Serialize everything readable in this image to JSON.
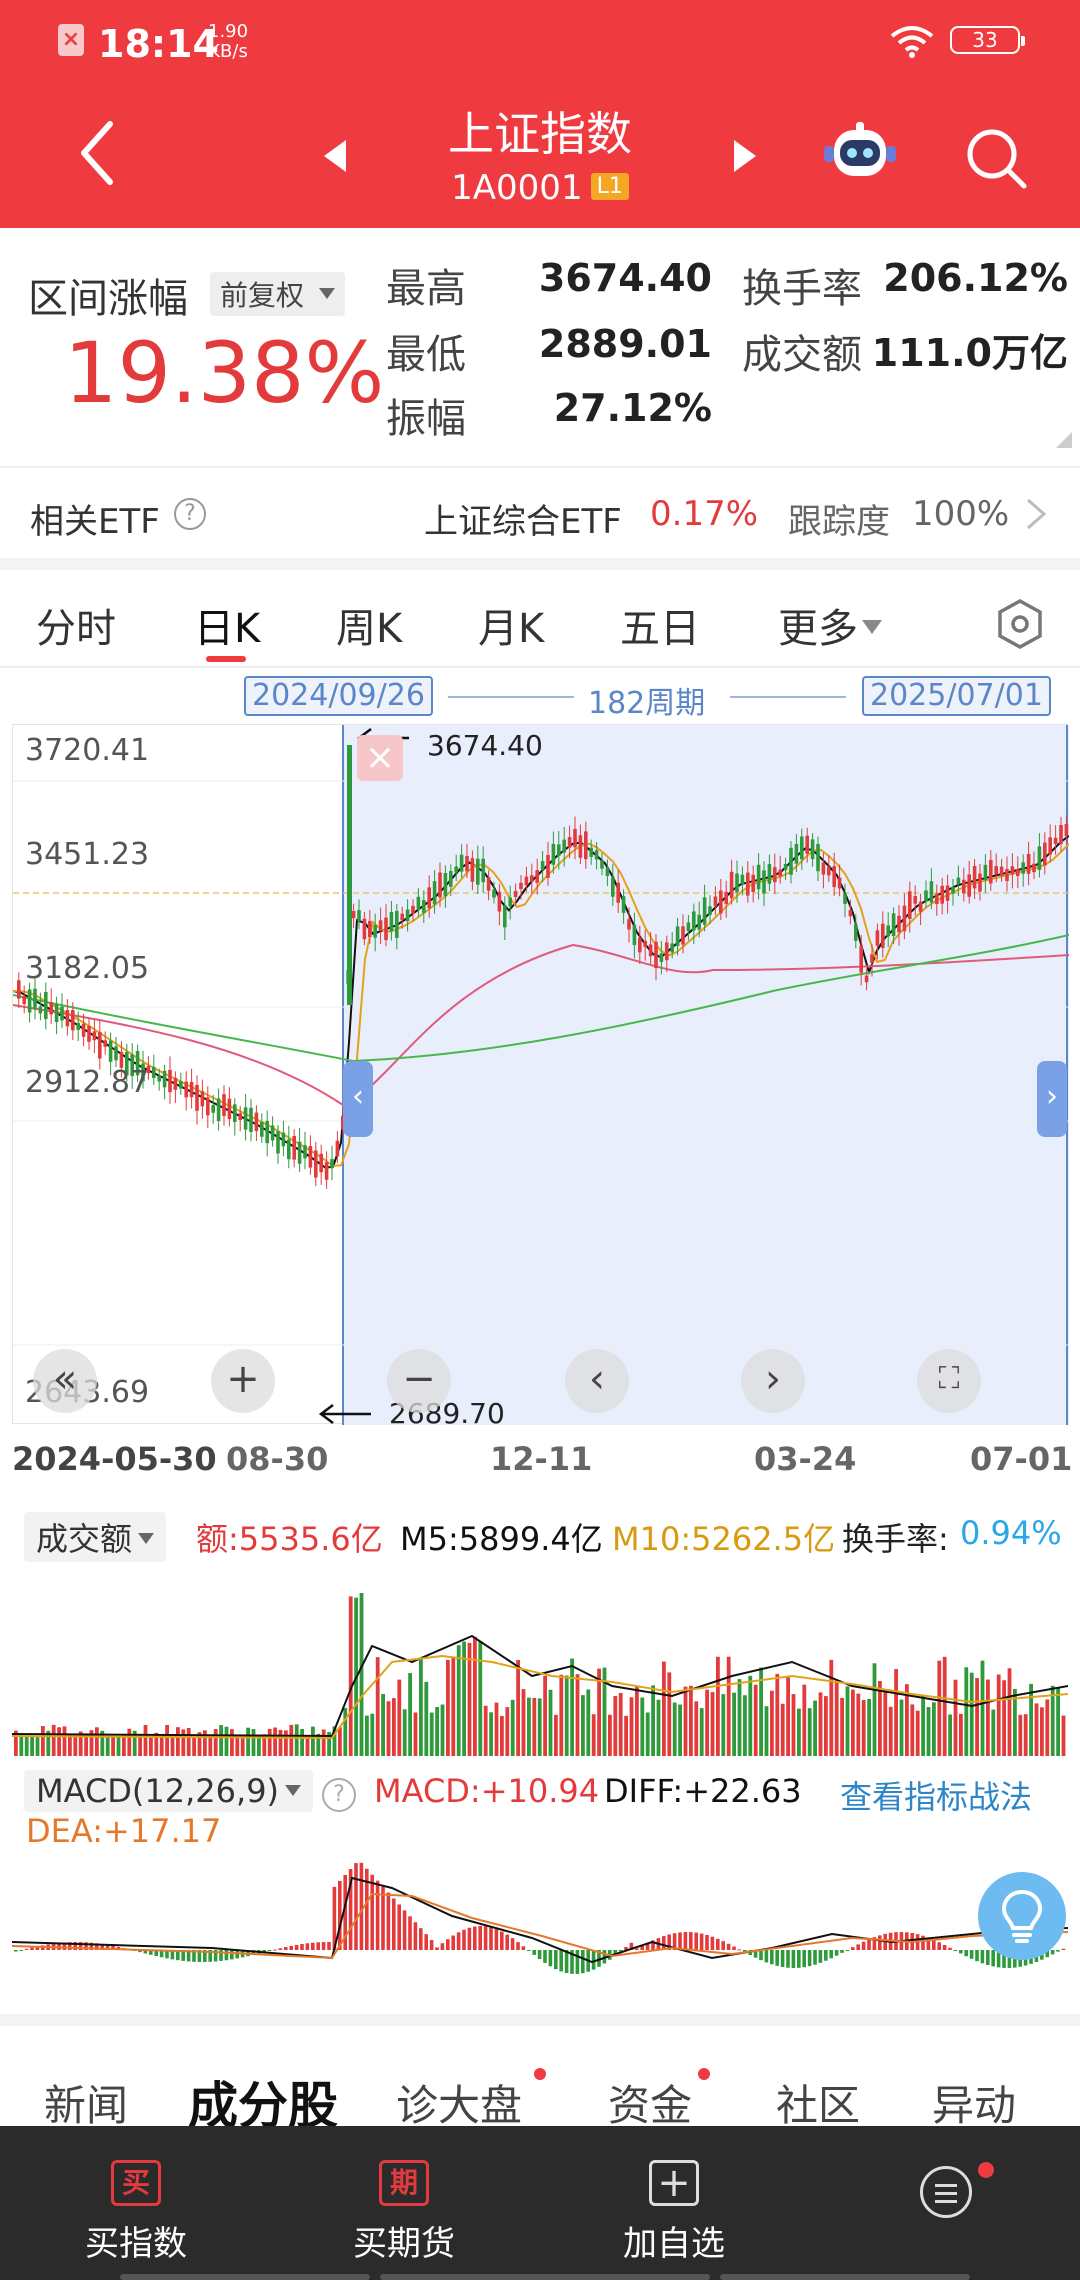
{
  "status": {
    "time": "18:14",
    "speed_value": "1.90",
    "speed_unit": "KB/s",
    "battery": "33"
  },
  "header": {
    "title": "上证指数",
    "code": "1A0001",
    "level": "L1"
  },
  "summary": {
    "range_label": "区间涨幅",
    "adj_label": "前复权",
    "range_change": "19.38%",
    "high_label": "最高",
    "high": "3674.40",
    "low_label": "最低",
    "low": "2889.01",
    "amp_label": "振幅",
    "amp": "27.12%",
    "turnover_label": "换手率",
    "turnover": "206.12%",
    "amount_label": "成交额",
    "amount": "111.0万亿"
  },
  "etf": {
    "label": "相关ETF",
    "name": "上证综合ETF",
    "change": "0.17%",
    "track_label": "跟踪度",
    "track": "100%"
  },
  "tabs": [
    "分时",
    "日K",
    "周K",
    "月K",
    "五日",
    "更多"
  ],
  "period": {
    "start": "2024/09/26",
    "label": "182周期",
    "end": "2025/07/01"
  },
  "chart": {
    "y_labels": [
      "3720.41",
      "3451.23",
      "3182.05",
      "2912.87",
      "2643.69"
    ],
    "high_marker": "3674.40",
    "low_marker": "2689.70",
    "x_labels": [
      "2024-05-30",
      "08-30",
      "12-11",
      "03-24",
      "07-01"
    ]
  },
  "volume": {
    "selector": "成交额",
    "amount": "额:5535.6亿",
    "m5": "M5:5899.4亿",
    "m10": "M10:5262.5亿",
    "turnover_label": "换手率:",
    "turnover": "0.94%"
  },
  "macd": {
    "selector": "MACD(12,26,9)",
    "macd": "MACD:+10.94",
    "diff": "DIFF:+22.63",
    "link": "查看指标战法",
    "dea": "DEA:+17.17"
  },
  "bottom_tabs": [
    "新闻",
    "成分股",
    "诊大盘",
    "资金",
    "社区",
    "异动"
  ],
  "bottom_bar": {
    "items": [
      {
        "icon": "买",
        "label": "买指数"
      },
      {
        "icon": "期",
        "label": "买期货"
      },
      {
        "icon": "+",
        "label": "加自选"
      }
    ]
  },
  "colors": {
    "brand": "#ef3a40",
    "up": "#e33b3b",
    "down": "#2e9a3b",
    "select_blue": "#5b86c9"
  }
}
